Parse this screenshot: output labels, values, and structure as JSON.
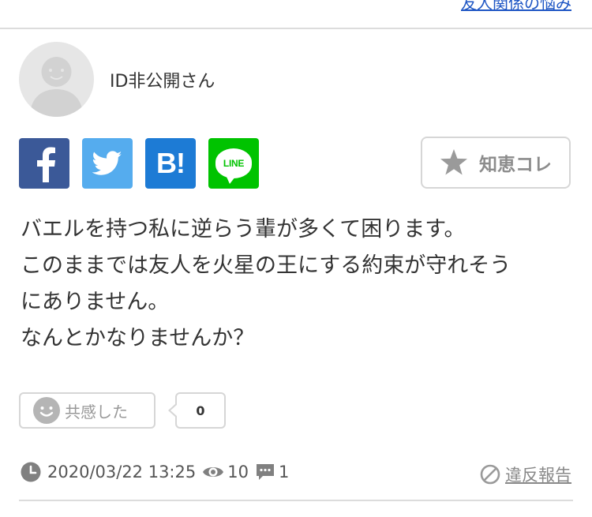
{
  "header": {
    "category_link": "友人関係の悩み"
  },
  "author": {
    "name": "ID非公開さん",
    "avatar_icon": "default-user-avatar"
  },
  "share": [
    {
      "name": "facebook-share-button",
      "icon": "facebook-icon",
      "color": "#3b5998"
    },
    {
      "name": "twitter-share-button",
      "icon": "twitter-icon",
      "color": "#55acee"
    },
    {
      "name": "hatena-bookmark-share-button",
      "icon": "hatena-bookmark-icon",
      "label": "B!",
      "color": "#1d7bd5"
    },
    {
      "name": "line-share-button",
      "icon": "line-icon",
      "label": "LINE",
      "color": "#00c300"
    }
  ],
  "chie_kore": {
    "label": "知恵コレ",
    "icon": "star-icon"
  },
  "question": {
    "lines": [
      "バエルを持つ私に逆らう輩が多くて困ります。",
      "このままでは友人を火星の王にする約束が守れそう",
      "にありません。",
      "なんとかなりませんか？"
    ]
  },
  "kyokan": {
    "label": "共感した",
    "count": "0",
    "icon": "smiley-face-icon"
  },
  "meta": {
    "date": "2020/03/22 13:25",
    "views": "10",
    "answers": "1",
    "clock_icon": "clock-icon",
    "views_icon": "eye-icon",
    "answers_icon": "comment-icon"
  },
  "report": {
    "label": "違反報告",
    "icon": "prohibited-icon"
  }
}
